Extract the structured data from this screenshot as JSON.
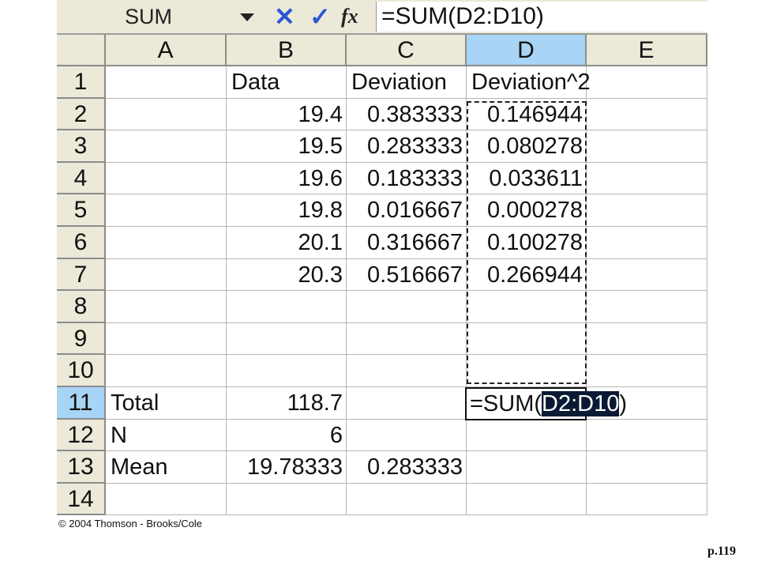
{
  "formula_bar": {
    "name_box": "SUM",
    "cancel_icon": "x-icon",
    "enter_icon": "check-icon",
    "function_icon": "fx-icon",
    "fx_label": "fx",
    "formula": "=SUM(D2:D10)"
  },
  "columns": [
    "A",
    "B",
    "C",
    "D",
    "E"
  ],
  "rows": [
    "1",
    "2",
    "3",
    "4",
    "5",
    "6",
    "7",
    "8",
    "9",
    "10",
    "11",
    "12",
    "13",
    "14"
  ],
  "cells": [
    [
      "",
      "Data",
      "Deviation",
      "Deviation^2",
      ""
    ],
    [
      "",
      "19.4",
      "0.383333",
      "0.146944",
      ""
    ],
    [
      "",
      "19.5",
      "0.283333",
      "0.080278",
      ""
    ],
    [
      "",
      "19.6",
      "0.183333",
      "0.033611",
      ""
    ],
    [
      "",
      "19.8",
      "0.016667",
      "0.000278",
      ""
    ],
    [
      "",
      "20.1",
      "0.316667",
      "0.100278",
      ""
    ],
    [
      "",
      "20.3",
      "0.516667",
      "0.266944",
      ""
    ],
    [
      "",
      "",
      "",
      "",
      ""
    ],
    [
      "",
      "",
      "",
      "",
      ""
    ],
    [
      "",
      "",
      "",
      "",
      ""
    ],
    [
      "Total",
      "118.7",
      "",
      "",
      ""
    ],
    [
      "N",
      "6",
      "",
      "",
      ""
    ],
    [
      "Mean",
      "19.78333",
      "0.283333",
      "",
      ""
    ],
    [
      "",
      "",
      "",
      "",
      ""
    ]
  ],
  "active_cell": {
    "column": "D",
    "row": "11",
    "edit_prefix": "=SUM(",
    "edit_selected": "D2:D10",
    "edit_suffix": ")"
  },
  "colors": {
    "selected_header": "#a8d4f5",
    "toolbar": "#ece9d8",
    "icon_blue": "#2b57d6"
  },
  "footer": {
    "copyright": "© 2004 Thomson - Brooks/Cole",
    "page": "p.119"
  }
}
